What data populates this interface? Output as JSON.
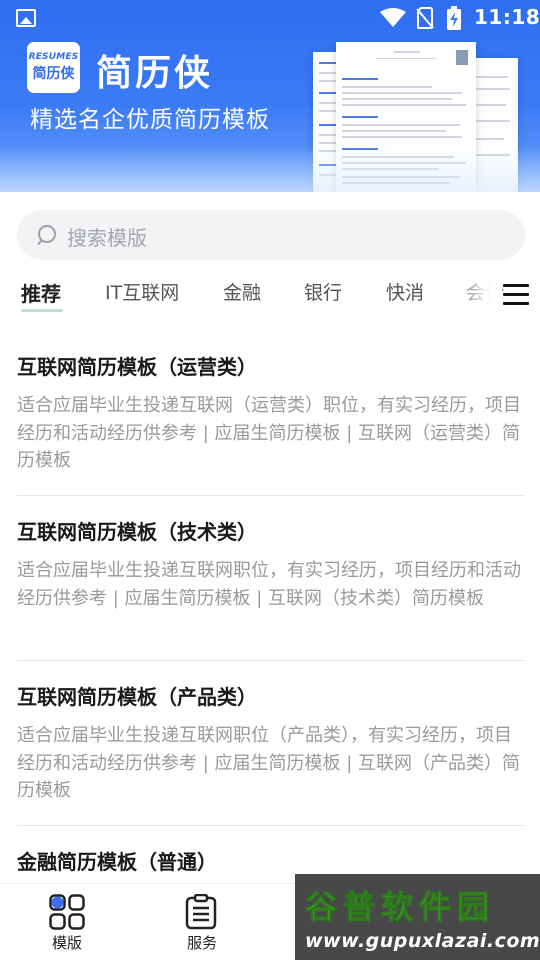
{
  "status_bar": {
    "time": "11:18",
    "icons": [
      "image-icon",
      "wifi-icon",
      "no-sim-icon",
      "battery-charging-icon"
    ]
  },
  "hero": {
    "logo_top": "RESUMES",
    "logo_bottom": "简历侠",
    "app_name": "简历侠",
    "slogan": "精选名企优质简历模板"
  },
  "search": {
    "placeholder": "搜索模版"
  },
  "tabs": {
    "items": [
      "推荐",
      "IT互联网",
      "金融",
      "银行",
      "快消",
      "会计"
    ],
    "active_index": 0
  },
  "templates": [
    {
      "title": "互联网简历模板（运营类）",
      "description": "适合应届毕业生投递互联网（运营类）职位，有实习经历，项目经历和活动经历供参考 | 应届生简历模板 | 互联网（运营类）简历模板"
    },
    {
      "title": "互联网简历模板（技术类）",
      "description": "适合应届毕业生投递互联网职位，有实习经历，项目经历和活动经历供参考 | 应届生简历模板 | 互联网（技术类）简历模板"
    },
    {
      "title": "互联网简历模板（产品类）",
      "description": "适合应届毕业生投递互联网职位（产品类），有实习经历，项目经历和活动经历供参考 | 应届生简历模板 | 互联网（产品类）简历模板"
    },
    {
      "title": "金融简历模板（普通）",
      "description": ""
    }
  ],
  "bottom_nav": {
    "items": [
      {
        "label": "模版",
        "icon": "grid-icon",
        "active": true
      },
      {
        "label": "服务",
        "icon": "document-list-icon",
        "active": false
      }
    ]
  },
  "watermark": {
    "title": "谷普软件园",
    "url": "www.gupuxlazai.com"
  },
  "colors": {
    "brand_blue": "#2f6df0",
    "accent_green": "#c5dcd2",
    "text_primary": "#1a1a1a",
    "text_secondary": "#9a9a9a"
  }
}
